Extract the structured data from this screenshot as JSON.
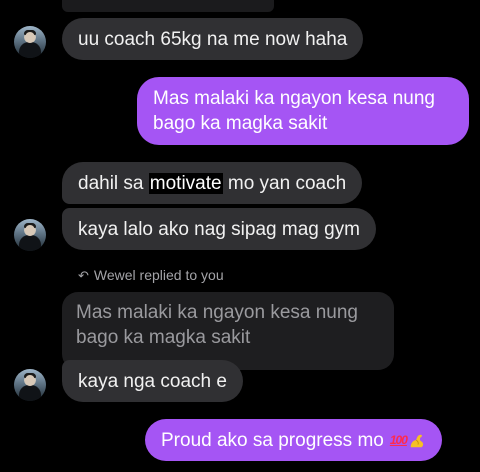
{
  "messages": [
    {
      "id": "m1",
      "sender": "them",
      "text": "uu coach 65kg na me now haha"
    },
    {
      "id": "m2",
      "sender": "me",
      "line1": "Mas malaki ka ngayon kesa nung",
      "line2": "bago ka magka sakit"
    },
    {
      "id": "m3",
      "sender": "them",
      "before": "dahil sa ",
      "highlight": "motivate",
      "after": " mo yan coach"
    },
    {
      "id": "m4",
      "sender": "them",
      "text": "kaya lalo ako nag sipag mag gym"
    },
    {
      "id": "m5",
      "sender": "them",
      "reply_label": "Wewel replied to you",
      "quoted_line1": "Mas malaki ka ngayon kesa nung",
      "quoted_line2": "bago ka magka sakit",
      "text": "kaya nga coach e"
    },
    {
      "id": "m6",
      "sender": "me",
      "text": "Proud ako sa progress mo",
      "emojis": [
        "hundred-points-emoji",
        "flexed-biceps-emoji"
      ],
      "emoji_100_text": "100"
    }
  ],
  "colors": {
    "background": "#000000",
    "incoming_bubble": "#303033",
    "outgoing_bubble": "#a555f4",
    "quoted_bubble": "#1e1e20",
    "reply_label": "#a4a4a8"
  },
  "icons": [
    "reply-arrow-icon"
  ]
}
